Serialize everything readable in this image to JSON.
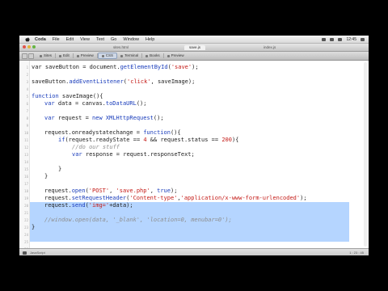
{
  "menu": {
    "app": "Coda",
    "items": [
      "File",
      "Edit",
      "View",
      "Text",
      "Go",
      "Window",
      "Help"
    ],
    "clock": "12:45"
  },
  "tabs": [
    "sites.html",
    "save.js",
    "index.js"
  ],
  "toolbar": {
    "items": [
      "Sites",
      "Edit",
      "Preview",
      "CSS",
      "Terminal",
      "Books",
      "Preview"
    ]
  },
  "editor": {
    "line_numbers": [
      "1",
      "2",
      "3",
      "4",
      "5",
      "6",
      "7",
      "8",
      "9",
      "10",
      "11",
      "12",
      "13",
      "14",
      "15",
      "16",
      "17",
      "18",
      "19",
      "20",
      "21",
      "22",
      "23",
      "24",
      "25",
      "26"
    ],
    "code": {
      "l1_a": "var saveButton = document.",
      "l1_fn": "getElementById",
      "l1_b": "(",
      "l1_str": "'save'",
      "l1_c": ");",
      "l3_a": "saveButton.",
      "l3_fn": "addEventListener",
      "l3_b": "(",
      "l3_str": "'click'",
      "l3_c": ", saveImage);",
      "l5_kw": "function",
      "l5_a": " saveImage(){",
      "l6_kw": "var",
      "l6_a": " data = canvas.",
      "l6_fn": "toDataURL",
      "l6_b": "();",
      "l8_kw": "var",
      "l8_a": " request = ",
      "l8_kw2": "new",
      "l8_b": " ",
      "l8_fn": "XMLHttpRequest",
      "l8_c": "();",
      "l10_a": "request.onreadystatechange = ",
      "l10_kw": "function",
      "l10_b": "(){",
      "l11_kw": "if",
      "l11_a": "(request.readyState == ",
      "l11_num": "4",
      "l11_b": " && request.status == ",
      "l11_num2": "200",
      "l11_c": "){",
      "l12_cm": "//do our stuff",
      "l13_kw": "var",
      "l13_a": " response = request.responseText;",
      "l15_a": "}",
      "l16_a": "}",
      "l18_a": "request.",
      "l18_fn": "open",
      "l18_b": "(",
      "l18_str": "'POST'",
      "l18_c": ", ",
      "l18_str2": "'save.php'",
      "l18_d": ", ",
      "l18_kw": "true",
      "l18_e": ");",
      "l19_a": "request.",
      "l19_fn": "setRequestHeader",
      "l19_b": "(",
      "l19_str": "'Content-type'",
      "l19_c": ",",
      "l19_str2": "'application/x-www-form-urlencoded'",
      "l19_d": ");",
      "l20_a": "request.",
      "l20_fn": "send",
      "l20_b": "(",
      "l20_str": "'img='",
      "l20_c": "+data);",
      "l22_cm": "//window.open(data, '_blank', 'location=0, menubar=0');",
      "l23_a": "}"
    }
  },
  "status": {
    "left": "JavaScript",
    "right": "1 : 23 : 45"
  },
  "colors": {
    "selection": "#b5d5ff",
    "keyword": "#1a3dbb",
    "string": "#c41a16",
    "comment": "#8e8e8e"
  }
}
